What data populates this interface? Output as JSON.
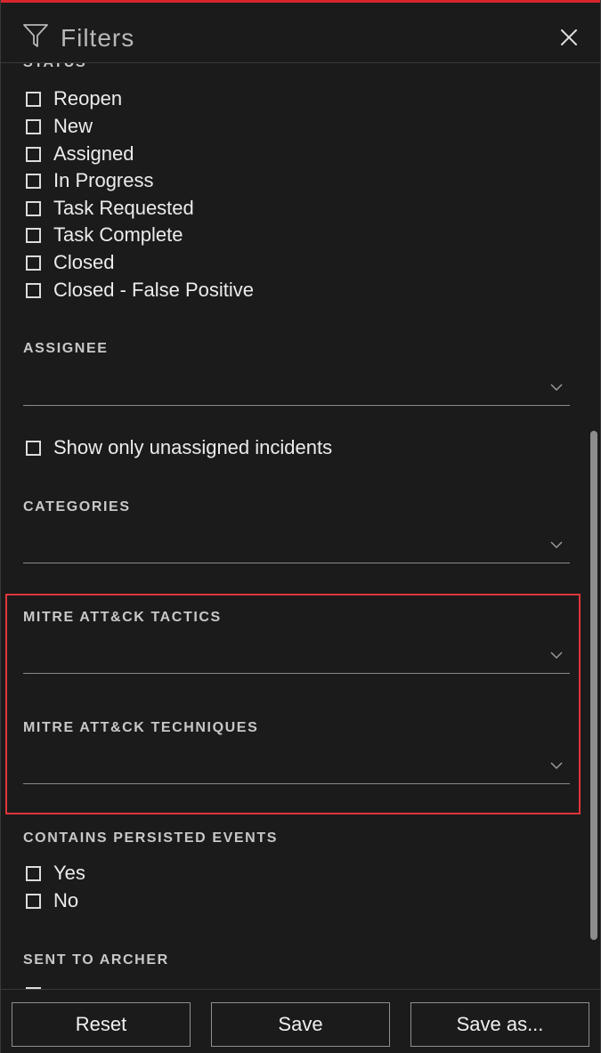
{
  "header": {
    "title": "Filters",
    "icons": {
      "filter": "filter-funnel-icon",
      "close": "close-x-icon"
    }
  },
  "status": {
    "label": "STATUS",
    "options": [
      "Reopen",
      "New",
      "Assigned",
      "In Progress",
      "Task Requested",
      "Task Complete",
      "Closed",
      "Closed - False Positive"
    ]
  },
  "assignee": {
    "label": "ASSIGNEE",
    "value": "",
    "unassigned_label": "Show only unassigned incidents"
  },
  "categories": {
    "label": "CATEGORIES",
    "value": ""
  },
  "mitre_tactics": {
    "label": "MITRE ATT&CK TACTICS",
    "value": ""
  },
  "mitre_techniques": {
    "label": "MITRE ATT&CK TECHNIQUES",
    "value": ""
  },
  "persisted_events": {
    "label": "CONTAINS PERSISTED EVENTS",
    "options": [
      "Yes",
      "No"
    ]
  },
  "sent_to_archer": {
    "label": "SENT TO ARCHER"
  },
  "footer": {
    "reset_label": "Reset",
    "save_label": "Save",
    "save_as_label": "Save as..."
  },
  "colors": {
    "background": "#1b1b1b",
    "accent_red": "#d6262b",
    "highlight_red": "#e0353b",
    "text": "#ececec",
    "label": "#c8c8c8"
  }
}
